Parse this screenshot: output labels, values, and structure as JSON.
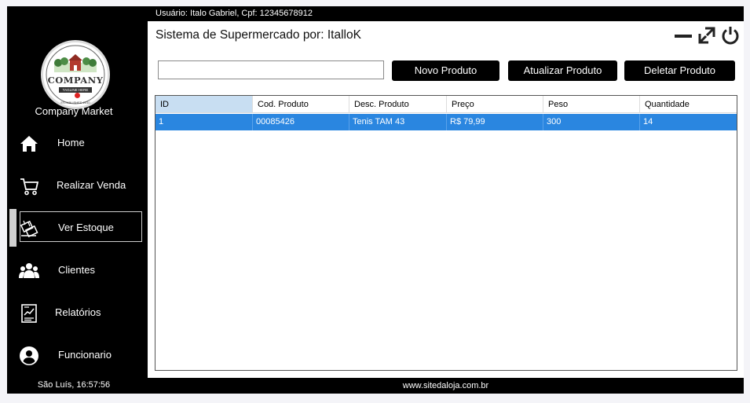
{
  "user_info": "Usuário: Italo Gabriel, Cpf: 12345678912",
  "title": "Sistema de Supermercado por: ItalloK",
  "logo": {
    "company": "COMPANY",
    "tagline": "TAGLINE HERE",
    "established": "ESTABLISHED 2010"
  },
  "company_name": "Company Market",
  "nav": {
    "home": "Home",
    "realizar_venda": "Realizar Venda",
    "ver_estoque": "Ver Estoque",
    "clientes": "Clientes",
    "relatorios": "Relatórios",
    "funcionario": "Funcionario"
  },
  "clock": "São Luís, 16:57:56",
  "search": {
    "value": "",
    "placeholder": ""
  },
  "buttons": {
    "novo": "Novo Produto",
    "atualizar": "Atualizar Produto",
    "deletar": "Deletar Produto"
  },
  "table": {
    "columns": [
      "ID",
      "Cod. Produto",
      "Desc. Produto",
      "Preço",
      "Peso",
      "Quantidade"
    ],
    "rows": [
      [
        "1",
        "00085426",
        "Tenis TAM 43",
        "R$ 79,99",
        "300",
        "14"
      ]
    ]
  },
  "footer": "www.sitedaloja.com.br",
  "colors": {
    "background": "#000000",
    "selected_row": "#2a86e0",
    "selected_header": "#c8def2"
  }
}
